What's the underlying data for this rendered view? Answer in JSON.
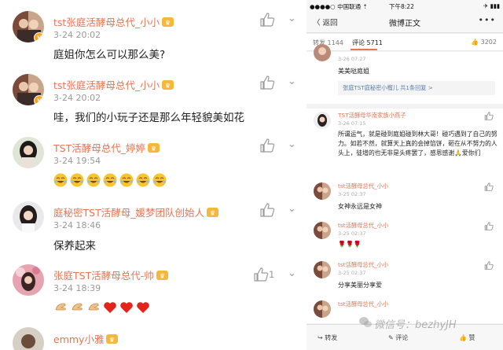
{
  "left": {
    "comments": [
      {
        "name": "tst张庭活酵母总代_小小",
        "time": "3-24 20:02",
        "text": "庭姐你怎么可以那么美?",
        "likes": ""
      },
      {
        "name": "tst张庭活酵母总代_小小",
        "time": "3-24 20:02",
        "text": "哇，我们的小玩子还是那么年轻貌美如花",
        "likes": ""
      },
      {
        "name": "TST活酵母总代_婷婷",
        "time": "3-24 19:54",
        "text": "",
        "likes": ""
      },
      {
        "name": "庭秘密TST活酵母_媛梦团队创始人",
        "time": "3-24 18:46",
        "text": "保养起来",
        "likes": ""
      },
      {
        "name": "张庭TST活酵母总代-帅",
        "time": "3-24 18:39",
        "text": "",
        "likes": "1"
      },
      {
        "name": "emmy小雅",
        "time": "",
        "text": "",
        "likes": ""
      }
    ],
    "colors": {
      "name": "#eb7350",
      "time": "#999999",
      "text": "#222222"
    }
  },
  "right": {
    "status": {
      "carrier": "●●●●○ 中国联通 ⇡",
      "time": "下午8:22",
      "battery": "✈ ▮▮▮"
    },
    "nav": {
      "back": "〈 返回",
      "title": "微博正文",
      "more": "•••"
    },
    "tabs": {
      "repost": "转发 1144",
      "comments": "评论 5711",
      "likes": "👍 3202"
    },
    "comments": [
      {
        "time": "3-26 07:27",
        "text": "美美哒庭姐",
        "reply": "张庭TST庭秘密小榴儿  共1条回复 >"
      },
      {
        "name": "TST活酵母华南家族小燕子",
        "time": "3-26 07:15",
        "text": "所谓运气，就是碰到庭姐碰到林大哥！碰巧遇到了自己的努力。如若不然，就算天上真的会掉馅饼，砸在从不努力的人头上，徒增的也无非是头疼罢了，感恩感谢🙏爱你们"
      },
      {
        "name": "tst活酵母总代_小小",
        "time": "3-25 02:37",
        "text": "女神永远是女神"
      },
      {
        "name": "tst活酵母总代_小小",
        "time": "3-25 02:37",
        "text": "🌹🌹🌹"
      },
      {
        "name": "tst活酵母总代_小小",
        "time": "3-25 02:37",
        "text": "分享美丽分享爱"
      },
      {
        "name": "tst活酵母总代_小小",
        "time": "",
        "text": ""
      }
    ],
    "bottom": {
      "repost": "转发",
      "comment": "评论",
      "like": "赞"
    },
    "watermark": "微信号：bezhyJH"
  }
}
